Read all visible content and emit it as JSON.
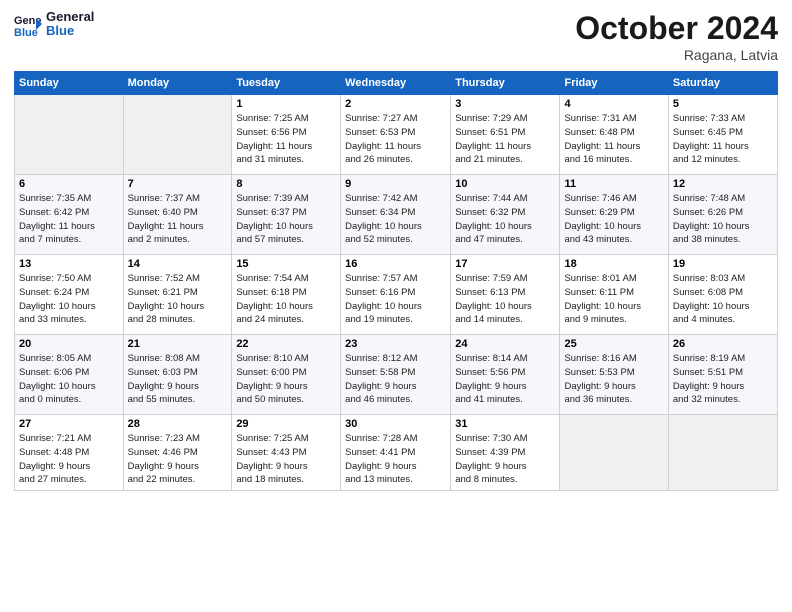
{
  "header": {
    "logo_line1": "General",
    "logo_line2": "Blue",
    "month": "October 2024",
    "location": "Ragana, Latvia"
  },
  "days_of_week": [
    "Sunday",
    "Monday",
    "Tuesday",
    "Wednesday",
    "Thursday",
    "Friday",
    "Saturday"
  ],
  "weeks": [
    [
      {
        "num": "",
        "info": ""
      },
      {
        "num": "",
        "info": ""
      },
      {
        "num": "1",
        "info": "Sunrise: 7:25 AM\nSunset: 6:56 PM\nDaylight: 11 hours\nand 31 minutes."
      },
      {
        "num": "2",
        "info": "Sunrise: 7:27 AM\nSunset: 6:53 PM\nDaylight: 11 hours\nand 26 minutes."
      },
      {
        "num": "3",
        "info": "Sunrise: 7:29 AM\nSunset: 6:51 PM\nDaylight: 11 hours\nand 21 minutes."
      },
      {
        "num": "4",
        "info": "Sunrise: 7:31 AM\nSunset: 6:48 PM\nDaylight: 11 hours\nand 16 minutes."
      },
      {
        "num": "5",
        "info": "Sunrise: 7:33 AM\nSunset: 6:45 PM\nDaylight: 11 hours\nand 12 minutes."
      }
    ],
    [
      {
        "num": "6",
        "info": "Sunrise: 7:35 AM\nSunset: 6:42 PM\nDaylight: 11 hours\nand 7 minutes."
      },
      {
        "num": "7",
        "info": "Sunrise: 7:37 AM\nSunset: 6:40 PM\nDaylight: 11 hours\nand 2 minutes."
      },
      {
        "num": "8",
        "info": "Sunrise: 7:39 AM\nSunset: 6:37 PM\nDaylight: 10 hours\nand 57 minutes."
      },
      {
        "num": "9",
        "info": "Sunrise: 7:42 AM\nSunset: 6:34 PM\nDaylight: 10 hours\nand 52 minutes."
      },
      {
        "num": "10",
        "info": "Sunrise: 7:44 AM\nSunset: 6:32 PM\nDaylight: 10 hours\nand 47 minutes."
      },
      {
        "num": "11",
        "info": "Sunrise: 7:46 AM\nSunset: 6:29 PM\nDaylight: 10 hours\nand 43 minutes."
      },
      {
        "num": "12",
        "info": "Sunrise: 7:48 AM\nSunset: 6:26 PM\nDaylight: 10 hours\nand 38 minutes."
      }
    ],
    [
      {
        "num": "13",
        "info": "Sunrise: 7:50 AM\nSunset: 6:24 PM\nDaylight: 10 hours\nand 33 minutes."
      },
      {
        "num": "14",
        "info": "Sunrise: 7:52 AM\nSunset: 6:21 PM\nDaylight: 10 hours\nand 28 minutes."
      },
      {
        "num": "15",
        "info": "Sunrise: 7:54 AM\nSunset: 6:18 PM\nDaylight: 10 hours\nand 24 minutes."
      },
      {
        "num": "16",
        "info": "Sunrise: 7:57 AM\nSunset: 6:16 PM\nDaylight: 10 hours\nand 19 minutes."
      },
      {
        "num": "17",
        "info": "Sunrise: 7:59 AM\nSunset: 6:13 PM\nDaylight: 10 hours\nand 14 minutes."
      },
      {
        "num": "18",
        "info": "Sunrise: 8:01 AM\nSunset: 6:11 PM\nDaylight: 10 hours\nand 9 minutes."
      },
      {
        "num": "19",
        "info": "Sunrise: 8:03 AM\nSunset: 6:08 PM\nDaylight: 10 hours\nand 4 minutes."
      }
    ],
    [
      {
        "num": "20",
        "info": "Sunrise: 8:05 AM\nSunset: 6:06 PM\nDaylight: 10 hours\nand 0 minutes."
      },
      {
        "num": "21",
        "info": "Sunrise: 8:08 AM\nSunset: 6:03 PM\nDaylight: 9 hours\nand 55 minutes."
      },
      {
        "num": "22",
        "info": "Sunrise: 8:10 AM\nSunset: 6:00 PM\nDaylight: 9 hours\nand 50 minutes."
      },
      {
        "num": "23",
        "info": "Sunrise: 8:12 AM\nSunset: 5:58 PM\nDaylight: 9 hours\nand 46 minutes."
      },
      {
        "num": "24",
        "info": "Sunrise: 8:14 AM\nSunset: 5:56 PM\nDaylight: 9 hours\nand 41 minutes."
      },
      {
        "num": "25",
        "info": "Sunrise: 8:16 AM\nSunset: 5:53 PM\nDaylight: 9 hours\nand 36 minutes."
      },
      {
        "num": "26",
        "info": "Sunrise: 8:19 AM\nSunset: 5:51 PM\nDaylight: 9 hours\nand 32 minutes."
      }
    ],
    [
      {
        "num": "27",
        "info": "Sunrise: 7:21 AM\nSunset: 4:48 PM\nDaylight: 9 hours\nand 27 minutes."
      },
      {
        "num": "28",
        "info": "Sunrise: 7:23 AM\nSunset: 4:46 PM\nDaylight: 9 hours\nand 22 minutes."
      },
      {
        "num": "29",
        "info": "Sunrise: 7:25 AM\nSunset: 4:43 PM\nDaylight: 9 hours\nand 18 minutes."
      },
      {
        "num": "30",
        "info": "Sunrise: 7:28 AM\nSunset: 4:41 PM\nDaylight: 9 hours\nand 13 minutes."
      },
      {
        "num": "31",
        "info": "Sunrise: 7:30 AM\nSunset: 4:39 PM\nDaylight: 9 hours\nand 8 minutes."
      },
      {
        "num": "",
        "info": ""
      },
      {
        "num": "",
        "info": ""
      }
    ]
  ]
}
